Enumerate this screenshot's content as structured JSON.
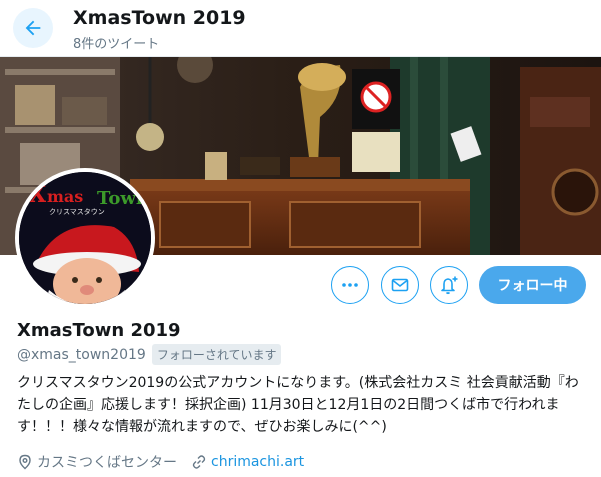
{
  "header": {
    "title": "XmasTown 2019",
    "tweet_count": "8件のツイート"
  },
  "banner": {
    "sign_text": "禁止"
  },
  "avatar": {
    "logo_text": "Xmas Town",
    "logo_sub": "クリスマスタウン"
  },
  "actions": {
    "more_label": "•••",
    "follow_label": "フォロー中"
  },
  "profile": {
    "name": "XmasTown 2019",
    "handle": "@xmas_town2019",
    "follows_you": "フォローされています",
    "bio": "クリスマスタウン2019の公式アカウントになります。(株式会社カスミ 社会貢献活動『わたしの企画』応援します！採択企画) 11月30日と12月1日の2日間つくば市で行われます！！！様々な情報が流れますので、ぜひお楽しみに(^^)",
    "location": "カスミつくばセンター",
    "website": "chrimachi.art"
  },
  "colors": {
    "accent": "#1da1f2",
    "follow_bg": "#4aa8ec",
    "link": "#1b95e0",
    "muted": "#657786"
  }
}
